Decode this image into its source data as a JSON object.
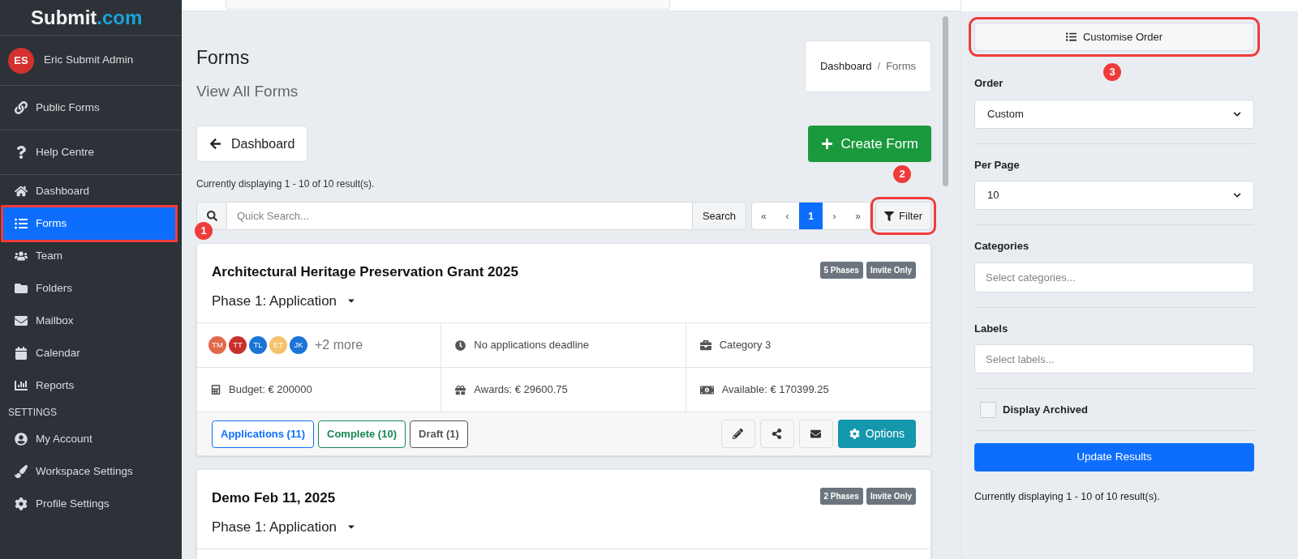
{
  "logo": {
    "name": "Submit",
    "suffix": ".com"
  },
  "user": {
    "initials": "ES",
    "name": "Eric Submit Admin"
  },
  "sidebar_items": [
    {
      "kind": "link",
      "label": "Public Forms",
      "selected": false,
      "divider_after": true
    },
    {
      "kind": "help",
      "label": "Help Centre",
      "selected": false,
      "divider_after": true
    },
    {
      "kind": "home",
      "label": "Dashboard",
      "selected": false,
      "divider_after": false
    },
    {
      "kind": "list",
      "label": "Forms",
      "selected": true,
      "divider_after": false,
      "callout": "1"
    },
    {
      "kind": "team",
      "label": "Team",
      "selected": false,
      "divider_after": false
    },
    {
      "kind": "folder",
      "label": "Folders",
      "selected": false,
      "divider_after": false
    },
    {
      "kind": "mail",
      "label": "Mailbox",
      "selected": false,
      "divider_after": false
    },
    {
      "kind": "calendar",
      "label": "Calendar",
      "selected": false,
      "divider_after": false
    },
    {
      "kind": "chart",
      "label": "Reports",
      "selected": false,
      "divider_after": false
    },
    {
      "kind": "heading",
      "label": "SETTINGS"
    },
    {
      "kind": "account",
      "label": "My Account",
      "selected": false,
      "divider_after": false
    },
    {
      "kind": "brush",
      "label": "Workspace Settings",
      "selected": false,
      "divider_after": false
    },
    {
      "kind": "gear",
      "label": "Profile Settings",
      "selected": false,
      "divider_after": false
    }
  ],
  "page": {
    "title": "Forms",
    "subtitle": "View All Forms",
    "breadcrumb": [
      "Dashboard",
      "Forms"
    ],
    "breadcrumb_separator": "/",
    "back_button": "Dashboard",
    "create_button": "Create Form",
    "result_summary": "Currently displaying 1 - 10 of 10 result(s)."
  },
  "toolbar": {
    "search_placeholder": "Quick Search...",
    "search_button": "Search",
    "pagination": [
      {
        "label": "«",
        "selected": false
      },
      {
        "label": "‹",
        "selected": false
      },
      {
        "label": "1",
        "selected": true
      },
      {
        "label": "›",
        "selected": false
      },
      {
        "label": "»",
        "selected": false
      }
    ],
    "filter_button": "Filter",
    "filter_callout": "2"
  },
  "forms": [
    {
      "title": "Architectural Heritage Preservation Grant 2025",
      "badges": [
        "5 Phases",
        "Invite Only"
      ],
      "phase": "Phase 1: Application",
      "members": [
        {
          "initials": "TM",
          "color": "#e0694a"
        },
        {
          "initials": "TT",
          "color": "#c9302c"
        },
        {
          "initials": "TL",
          "color": "#1b74d8"
        },
        {
          "initials": "ET",
          "color": "#f5c26b"
        },
        {
          "initials": "JK",
          "color": "#1b74d8"
        }
      ],
      "more_members": "+2 more",
      "deadline": "No applications deadline",
      "category": "Category 3",
      "budget": "Budget: € 200000",
      "awards": "Awards: € 29600.75",
      "available": "Available: € 170399.25",
      "status_buttons": [
        {
          "kind": "applications",
          "label": "Applications (11)"
        },
        {
          "kind": "complete",
          "label": "Complete (10)"
        },
        {
          "kind": "draft",
          "label": "Draft (1)"
        }
      ],
      "options_button": "Options"
    },
    {
      "title": "Demo Feb 11, 2025",
      "badges": [
        "2 Phases",
        "Invite Only"
      ],
      "phase": "Phase 1: Application"
    }
  ],
  "filter_panel": {
    "customise_button": "Customise Order",
    "customise_callout": "3",
    "order": {
      "label": "Order",
      "value": "Custom"
    },
    "per_page": {
      "label": "Per Page",
      "value": "10"
    },
    "categories": {
      "label": "Categories",
      "placeholder": "Select categories..."
    },
    "labels": {
      "label": "Labels",
      "placeholder": "Select labels..."
    },
    "display_archived": {
      "label": "Display Archived",
      "checked": false
    },
    "update_button": "Update Results",
    "result_summary": "Currently displaying 1 - 10 of 10 result(s)."
  }
}
